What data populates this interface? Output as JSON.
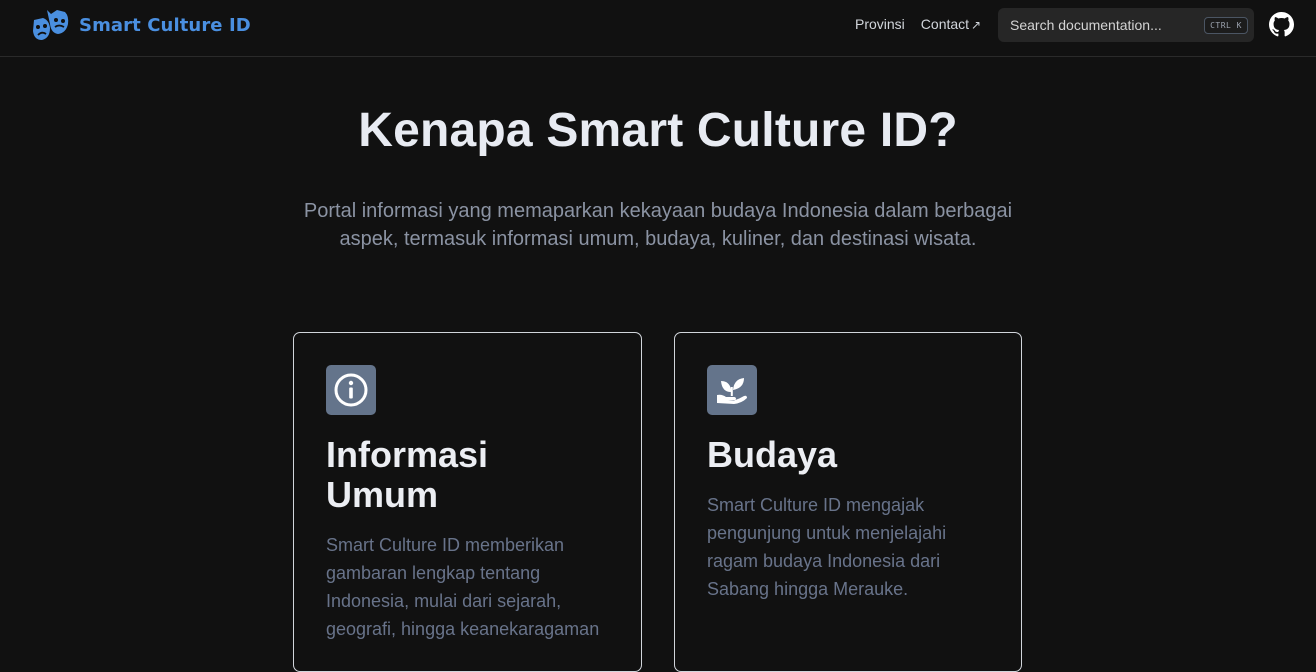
{
  "nav": {
    "brand": "Smart Culture ID",
    "links": [
      {
        "label": "Provinsi"
      },
      {
        "label": "Contact",
        "external_icon": "↗"
      }
    ],
    "search": {
      "placeholder": "Search documentation...",
      "shortcut": "CTRL K"
    },
    "github_icon": "github-icon"
  },
  "hero": {
    "title": "Kenapa Smart Culture ID?",
    "subtitle": "Portal informasi yang memaparkan kekayaan budaya Indonesia dalam berbagai aspek, termasuk informasi umum, budaya, kuliner, dan destinasi wisata."
  },
  "cards": [
    {
      "icon": "info-icon",
      "title": "Informasi Umum",
      "text": "Smart Culture ID memberikan gambaran lengkap tentang Indonesia, mulai dari sejarah, geografi, hingga keanekaragaman"
    },
    {
      "icon": "plant-hand-icon",
      "title": "Budaya",
      "text": "Smart Culture ID mengajak pengunjung untuk menjelajahi ragam budaya Indonesia dari Sabang hingga Merauke."
    }
  ],
  "colors": {
    "background": "#111111",
    "brand": "#4a8fe0",
    "icon_bg": "#64748b",
    "card_border": "#d1d5db",
    "muted_text": "#68738a"
  }
}
